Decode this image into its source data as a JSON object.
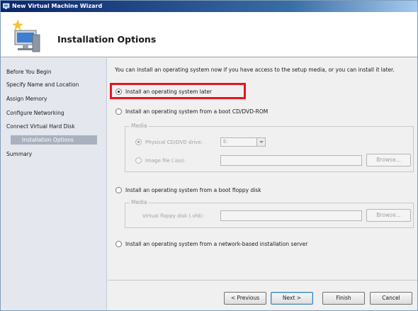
{
  "window": {
    "title": "New Virtual Machine Wizard"
  },
  "header": {
    "title": "Installation Options"
  },
  "nav": {
    "items": [
      {
        "label": "Before You Begin"
      },
      {
        "label": "Specify Name and Location"
      },
      {
        "label": "Assign Memory"
      },
      {
        "label": "Configure Networking"
      },
      {
        "label": "Connect Virtual Hard Disk"
      },
      {
        "label": "Installation Options",
        "selected": true
      },
      {
        "label": "Summary"
      }
    ]
  },
  "main": {
    "intro": "You can install an operating system now if you have access to the setup media, or you can install it later.",
    "options": {
      "later": {
        "label": "Install an operating system later",
        "checked": true
      },
      "cd": {
        "label": "Install an operating system from a boot CD/DVD-ROM",
        "checked": false,
        "media_label": "Media",
        "physical_label": "Physical CD/DVD drive:",
        "physical_value": "E:",
        "image_label": "Image file (.iso):",
        "image_value": "",
        "browse_label": "Browse..."
      },
      "floppy": {
        "label": "Install an operating system from a boot floppy disk",
        "checked": false,
        "media_label": "Media",
        "vfd_label": "Virtual floppy disk (.vfd):",
        "vfd_value": "",
        "browse_label": "Browse..."
      },
      "network": {
        "label": "Install an operating system from a network-based installation server",
        "checked": false
      }
    }
  },
  "footer": {
    "previous_label": "< Previous",
    "next_label": "Next >",
    "finish_label": "Finish",
    "cancel_label": "Cancel"
  },
  "colors": {
    "highlight": "#e8141c",
    "nav_selected": "#a9b1bf",
    "titlebar": "#0a246a"
  },
  "icons": {
    "app": "vm-wizard-icon",
    "header": "computer-sparkle-icon"
  }
}
